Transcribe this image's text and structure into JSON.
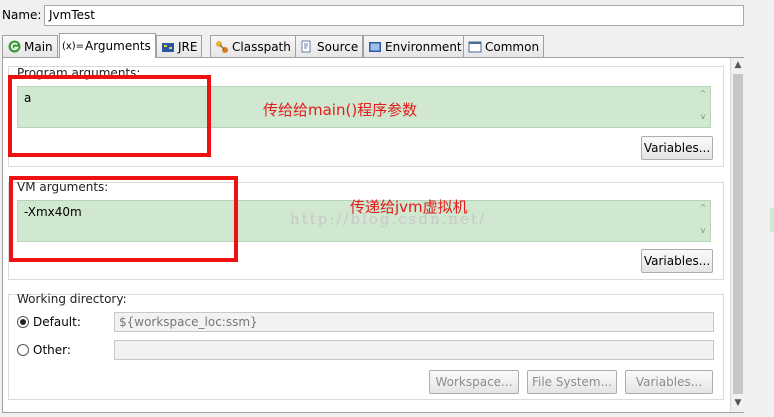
{
  "name": {
    "label": "Name:",
    "value": "JvmTest"
  },
  "tabs": [
    {
      "label": "Main",
      "icon": "main-icon"
    },
    {
      "label": "Arguments",
      "icon": "arguments-icon"
    },
    {
      "label": "JRE",
      "icon": "jre-icon"
    },
    {
      "label": "Classpath",
      "icon": "classpath-icon"
    },
    {
      "label": "Source",
      "icon": "source-icon"
    },
    {
      "label": "Environment",
      "icon": "environment-icon"
    },
    {
      "label": "Common",
      "icon": "common-icon"
    }
  ],
  "active_tab": "Arguments",
  "program_args": {
    "title": "Program arguments:",
    "value": "a",
    "variables_label": "Variables...",
    "annotation": "传给给main()程序参数"
  },
  "vm_args": {
    "title": "VM arguments:",
    "value": "-Xmx40m",
    "variables_label": "Variables...",
    "annotation": "传递给jvm虚拟机"
  },
  "working_dir": {
    "title": "Working directory:",
    "default_label": "Default:",
    "default_value": "${workspace_loc:ssm}",
    "other_label": "Other:",
    "other_value": "",
    "selected": "Default",
    "workspace_label": "Workspace...",
    "filesystem_label": "File System...",
    "variables_label": "Variables..."
  },
  "watermark": "http://blog.csdn.net/",
  "colors": {
    "annotation": "#e21b1b",
    "textarea_bg": "#cfe8cf"
  }
}
